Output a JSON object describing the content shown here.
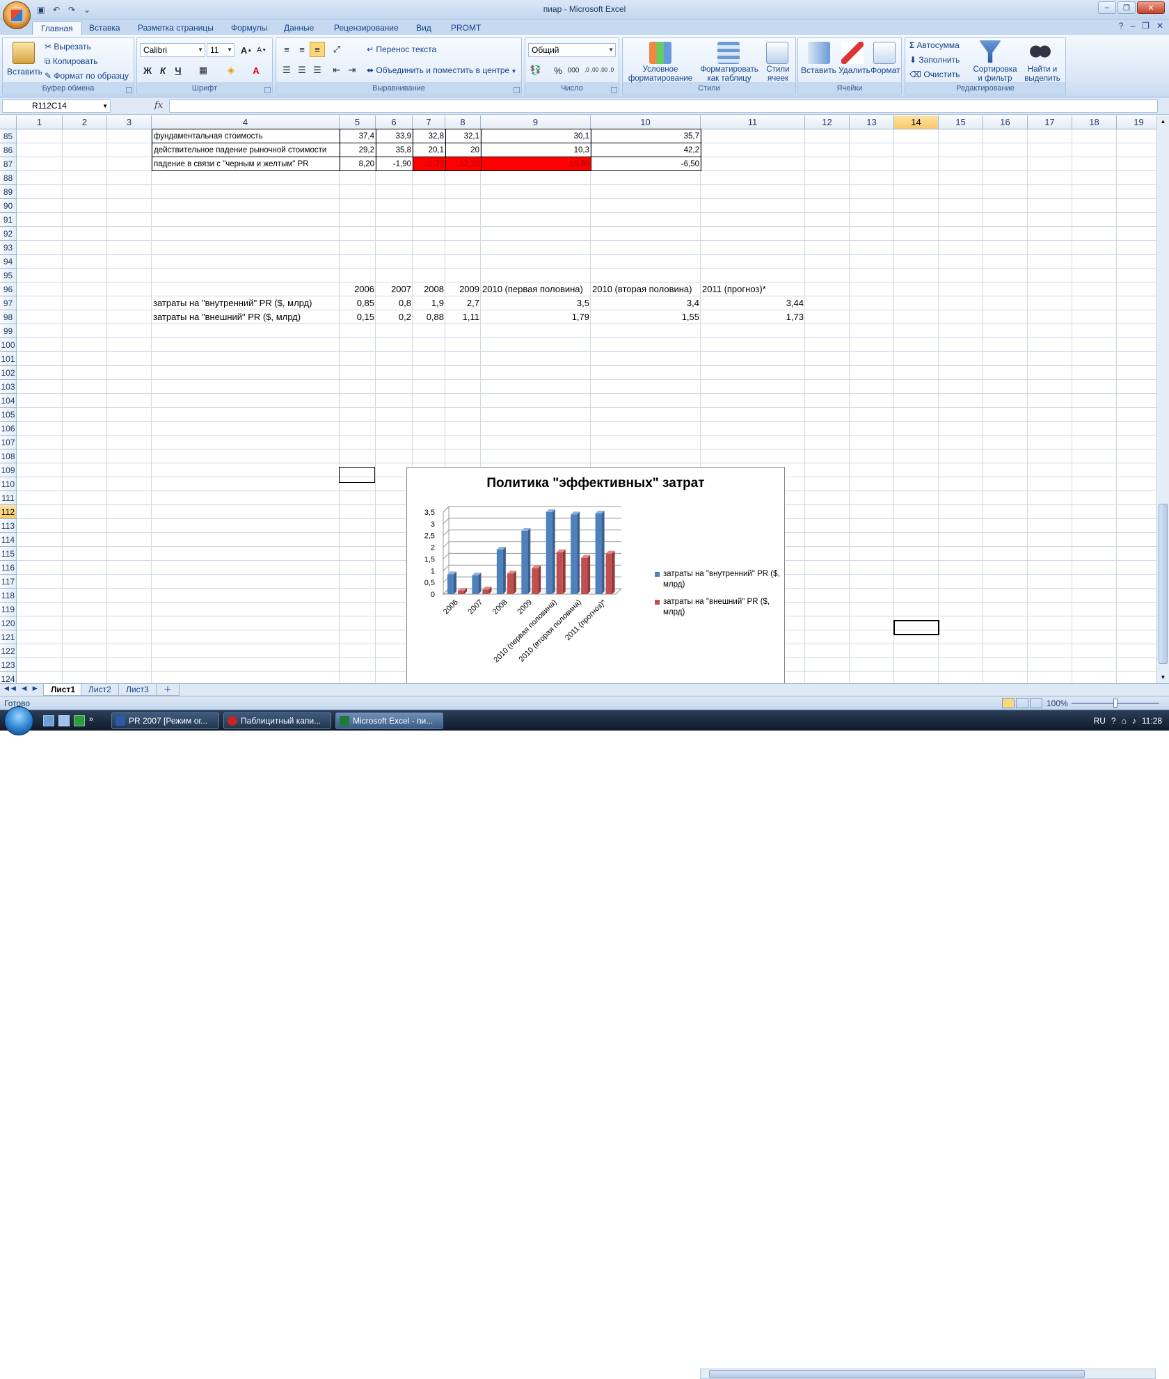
{
  "window": {
    "title": "пиар - Microsoft Excel"
  },
  "ribbon_tabs": [
    "Главная",
    "Вставка",
    "Разметка страницы",
    "Формулы",
    "Данные",
    "Рецензирование",
    "Вид",
    "PROMT"
  ],
  "clipboard": {
    "paste": "Вставить",
    "cut": "Вырезать",
    "copy": "Копировать",
    "format_painter": "Формат по образцу",
    "label": "Буфер обмена"
  },
  "font": {
    "name": "Calibri",
    "size": "11",
    "label": "Шрифт",
    "bold": "Ж",
    "italic": "К",
    "underline": "Ч"
  },
  "alignment": {
    "wrap": "Перенос текста",
    "merge": "Объединить и поместить в центре",
    "label": "Выравнивание"
  },
  "number": {
    "format": "Общий",
    "label": "Число",
    "percent": "%",
    "thousands": "000",
    "inc_dec": ",0 ,00",
    "dec_dec": ",00 ,0"
  },
  "styles": {
    "conditional": "Условное форматирование",
    "as_table": "Форматировать как таблицу",
    "cell_styles": "Стили ячеек",
    "label": "Стили"
  },
  "cells": {
    "insert": "Вставить",
    "delete": "Удалить",
    "format": "Формат",
    "label": "Ячейки"
  },
  "editing": {
    "autosum": "Автосумма",
    "fill": "Заполнить",
    "clear": "Очистить",
    "sort": "Сортировка и фильтр",
    "find": "Найти и выделить",
    "label": "Редактирование"
  },
  "formula_bar": {
    "name_box": "R112C14",
    "fx": "fx",
    "value": ""
  },
  "columns": [
    "1",
    "2",
    "3",
    "4",
    "5",
    "6",
    "7",
    "8",
    "9",
    "10",
    "11",
    "12",
    "13",
    "14",
    "15",
    "16",
    "17",
    "18",
    "19"
  ],
  "selected_column": "14",
  "rows": [
    "85",
    "86",
    "87",
    "88",
    "89",
    "90",
    "91",
    "92",
    "93",
    "94",
    "95",
    "96",
    "97",
    "98",
    "99",
    "100",
    "101",
    "102",
    "103",
    "104",
    "105",
    "106",
    "107",
    "108",
    "109",
    "110",
    "111",
    "112",
    "113",
    "114",
    "115",
    "116",
    "117",
    "118",
    "119",
    "120",
    "121",
    "122",
    "123",
    "124"
  ],
  "selected_row": "112",
  "table1": [
    {
      "label": "фундаментальная стоимость",
      "values": [
        "37,4",
        "33,9",
        "32,8",
        "32,1",
        "30,1",
        "35,7"
      ],
      "red": [
        false,
        false,
        false,
        false,
        false,
        false
      ]
    },
    {
      "label": "действительное падение рыночной стоимости",
      "values": [
        "29,2",
        "35,8",
        "20,1",
        "20",
        "10,3",
        "42,2"
      ],
      "red": [
        false,
        false,
        false,
        false,
        false,
        false
      ]
    },
    {
      "label": "падение в связи с \"черным и желтым\" PR",
      "values": [
        "8,20",
        "-1,90",
        "12,70",
        "12,10",
        "19,80",
        "-6,50"
      ],
      "red": [
        false,
        false,
        true,
        true,
        true,
        false
      ]
    }
  ],
  "table2": {
    "headers": [
      "2006",
      "2007",
      "2008",
      "2009",
      "2010 (первая половина)",
      "2010 (вторая половина)",
      "2011 (прогноз)*"
    ],
    "rows": [
      {
        "label": "затраты на \"внутренний\" PR ($, млрд)",
        "values": [
          "0,85",
          "0,8",
          "1,9",
          "2,7",
          "3,5",
          "3,4",
          "3,44"
        ]
      },
      {
        "label": "затраты на \"внешний\" PR ($, млрд)",
        "values": [
          "0,15",
          "0,2",
          "0,88",
          "1,11",
          "1,79",
          "1,55",
          "1,73"
        ]
      }
    ]
  },
  "chart_data": {
    "type": "bar",
    "title": "Политика \"эффективных\" затрат",
    "categories": [
      "2006",
      "2007",
      "2008",
      "2009",
      "2010 (первая половина)",
      "2010 (вторая половина)",
      "2011 (прогноз)*"
    ],
    "series": [
      {
        "name": "затраты на \"внутренний\" PR ($, млрд)",
        "values": [
          0.85,
          0.8,
          1.9,
          2.7,
          3.5,
          3.4,
          3.44
        ],
        "color": "#4f81bd"
      },
      {
        "name": "затраты на \"внешний\" PR ($, млрд)",
        "values": [
          0.15,
          0.2,
          0.88,
          1.11,
          1.79,
          1.55,
          1.73
        ],
        "color": "#c0504d"
      }
    ],
    "yticks": [
      "0",
      "0,5",
      "1",
      "1,5",
      "2",
      "2,5",
      "3",
      "3,5"
    ],
    "ylim": [
      0,
      3.5
    ],
    "legend": "right",
    "grid": true
  },
  "sheets": [
    "Лист1",
    "Лист2",
    "Лист3"
  ],
  "status": {
    "ready": "Готово",
    "zoom": "100%"
  },
  "taskbar": {
    "items": [
      "PR 2007 [Режим ог...",
      "Паблицитный капи...",
      "Microsoft Excel - пи..."
    ],
    "lang": "RU",
    "time": "11:28"
  }
}
